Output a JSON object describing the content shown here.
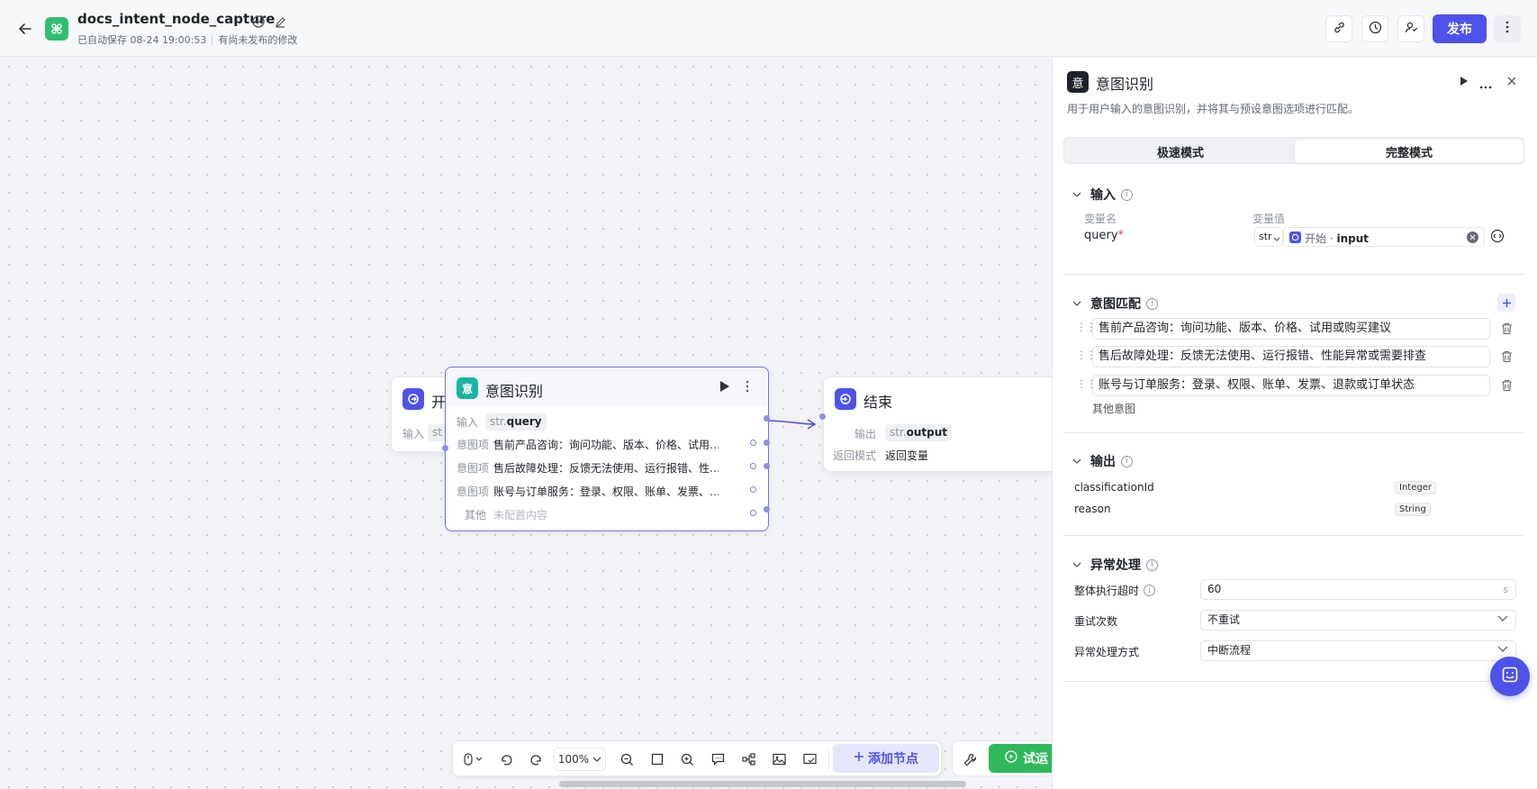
{
  "header": {
    "title": "docs_intent_node_capture",
    "autosave": "已自动保存 08-24 19:00:53",
    "unpublished": "有尚未发布的修改",
    "publish_label": "发布"
  },
  "canvas": {
    "start_node": {
      "title_partial": "开",
      "input_label": "输入",
      "input_chip_partial": "st"
    },
    "intent_node": {
      "icon_glyph": "意",
      "title": "意图识别",
      "input_label": "输入",
      "input_type": "str.",
      "input_name": "query",
      "items": [
        {
          "label": "意图项",
          "text": "售前产品咨询：询问功能、版本、价格、试用…"
        },
        {
          "label": "意图项",
          "text": "售后故障处理：反馈无法使用、运行报错、性…"
        },
        {
          "label": "意图项",
          "text": "账号与订单服务：登录、权限、账单、发票、…"
        }
      ],
      "other_label": "其他",
      "other_value": "未配置内容"
    },
    "end_node": {
      "title": "结束",
      "output_label": "输出",
      "output_type": "str.",
      "output_name": "output",
      "mode_label": "返回模式",
      "mode_value": "返回变量"
    }
  },
  "toolbar": {
    "zoom": "100%",
    "add_node_label": "添加节点",
    "test_run_partial": "试运"
  },
  "panel": {
    "icon_glyph": "意",
    "title": "意图识别",
    "description": "用于用户输入的意图识别，并将其与预设意图选项进行匹配。",
    "tabs": [
      "极速模式",
      "完整模式"
    ],
    "active_tab": 1,
    "input_section": {
      "title": "输入",
      "var_name_header": "变量名",
      "var_value_header": "变量值",
      "var_name": "query",
      "required_mark": "*",
      "type_value": "str",
      "source_node": "开始",
      "source_sep": "·",
      "source_var": "input"
    },
    "intent_section": {
      "title": "意图匹配",
      "items": [
        "售前产品咨询：询问功能、版本、价格、试用或购买建议",
        "售后故障处理：反馈无法使用、运行报错、性能异常或需要排查",
        "账号与订单服务：登录、权限、账单、发票、退款或订单状态"
      ],
      "other_label": "其他意图"
    },
    "output_section": {
      "title": "输出",
      "fields": [
        {
          "name": "classificationId",
          "type": "Integer"
        },
        {
          "name": "reason",
          "type": "String"
        }
      ]
    },
    "error_section": {
      "title": "异常处理",
      "timeout_label": "整体执行超时",
      "timeout_value": "60",
      "timeout_unit": "s",
      "retry_label": "重试次数",
      "retry_value": "不重试",
      "handling_label": "异常处理方式",
      "handling_value": "中断流程"
    }
  },
  "colors": {
    "accent": "#4d53e8",
    "app_icon": "#2fbf71",
    "intent_icon": "#19b4a4",
    "run_green": "#2fb85b"
  },
  "icons": {
    "header": [
      "back-arrow-icon",
      "workflow-app-icon",
      "check-circle-icon",
      "edit-pencil-icon",
      "link-icon",
      "history-clock-icon",
      "collaborator-icon",
      "more-vertical-icon"
    ],
    "panel": [
      "play-icon",
      "more-horizontal-icon",
      "close-icon",
      "info-icon",
      "plus-icon",
      "drag-handle-icon",
      "trash-icon",
      "chevron-down-icon"
    ],
    "toolbar": [
      "mouse-icon",
      "undo-icon",
      "redo-icon",
      "zoom-out-icon",
      "fit-view-icon",
      "zoom-in-icon",
      "comment-icon",
      "layout-icon",
      "image-icon",
      "minimap-icon",
      "wrench-icon",
      "play-circle-icon"
    ]
  }
}
